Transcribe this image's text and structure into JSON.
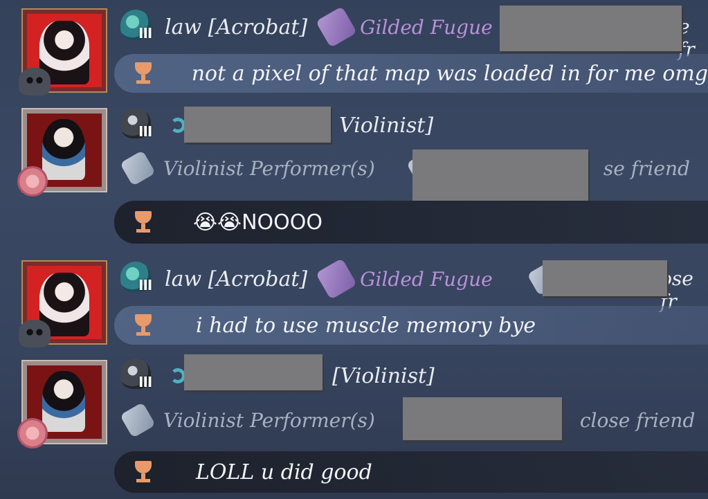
{
  "messages": [
    {
      "sender": "law [Acrobat]",
      "badge": "Gilded Fugue",
      "trailing_fragment": "e fr",
      "text": "not a pixel of that map was loaded in for me omg"
    },
    {
      "sender_suffix": "Violinist]",
      "badge": "Violinist Performer(s)",
      "trailing_fragment": "se friend",
      "text": "😭😭NOOOO"
    },
    {
      "sender": "law [Acrobat]",
      "badge": "Gilded Fugue",
      "trailing_fragment": "ose fr",
      "text": "i had to use muscle memory bye"
    },
    {
      "sender_suffix": "[Violinist]",
      "badge": "Violinist Performer(s)",
      "trailing_fragment": "close friend",
      "text": "LOLL u did good"
    }
  ],
  "rank_tier": "III",
  "icons": {
    "rank_teal": "teal-rank-emblem-icon",
    "rank_dark": "dark-rank-emblem-icon",
    "badge_purple": "purple-tag-icon",
    "badge_silver": "silver-tag-icon",
    "trophy": "trophy-icon",
    "ring": "ring-icon"
  },
  "colors": {
    "background": "#37445e",
    "badge_purple": "#b892d8",
    "badge_grey": "#a8b2c2",
    "trophy": "#e89a6a"
  }
}
